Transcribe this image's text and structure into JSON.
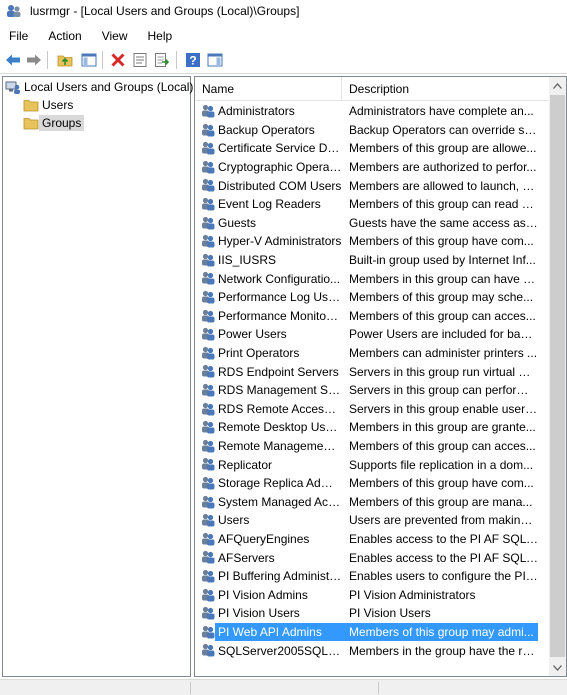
{
  "window": {
    "title": "lusrmgr - [Local Users and Groups (Local)\\Groups]",
    "icon": "users-app-icon"
  },
  "menu": [
    "File",
    "Action",
    "View",
    "Help"
  ],
  "toolbar": {
    "buttons": [
      "back-icon",
      "forward-icon",
      "up-folder-icon",
      "show-hide-tree-icon",
      "delete-icon",
      "properties-icon",
      "export-list-icon",
      "help-icon",
      "show-hide-action-pane-icon"
    ]
  },
  "tree": {
    "root": "Local Users and Groups (Local)",
    "children": [
      "Users",
      "Groups"
    ],
    "selected": "Groups"
  },
  "list": {
    "columns": {
      "name": "Name",
      "description": "Description"
    },
    "selected_index": 28,
    "rows": [
      {
        "name": "Administrators",
        "description": "Administrators have complete an..."
      },
      {
        "name": "Backup Operators",
        "description": "Backup Operators can override se..."
      },
      {
        "name": "Certificate Service DC...",
        "description": "Members of this group are allowe..."
      },
      {
        "name": "Cryptographic Operat...",
        "description": "Members are authorized to perfor..."
      },
      {
        "name": "Distributed COM Users",
        "description": "Members are allowed to launch, a..."
      },
      {
        "name": "Event Log Readers",
        "description": "Members of this group can read e..."
      },
      {
        "name": "Guests",
        "description": "Guests have the same access as m..."
      },
      {
        "name": "Hyper-V Administrators",
        "description": "Members of this group have com..."
      },
      {
        "name": "IIS_IUSRS",
        "description": "Built-in group used by Internet Inf..."
      },
      {
        "name": "Network Configuratio...",
        "description": "Members in this group can have s..."
      },
      {
        "name": "Performance Log Users",
        "description": "Members of this group may sche..."
      },
      {
        "name": "Performance Monitor ...",
        "description": "Members of this group can acces..."
      },
      {
        "name": "Power Users",
        "description": "Power Users are included for back..."
      },
      {
        "name": "Print Operators",
        "description": "Members can administer printers ..."
      },
      {
        "name": "RDS Endpoint Servers",
        "description": "Servers in this group run virtual m..."
      },
      {
        "name": "RDS Management Ser...",
        "description": "Servers in this group can perform ..."
      },
      {
        "name": "RDS Remote Access S...",
        "description": "Servers in this group enable users ..."
      },
      {
        "name": "Remote Desktop Users",
        "description": "Members in this group are grante..."
      },
      {
        "name": "Remote Management...",
        "description": "Members of this group can acces..."
      },
      {
        "name": "Replicator",
        "description": "Supports file replication in a dom..."
      },
      {
        "name": "Storage Replica Admi...",
        "description": "Members of this group have com..."
      },
      {
        "name": "System Managed Acc...",
        "description": "Members of this group are mana..."
      },
      {
        "name": "Users",
        "description": "Users are prevented from making ..."
      },
      {
        "name": "AFQueryEngines",
        "description": "Enables access to the PI AF SQL D..."
      },
      {
        "name": "AFServers",
        "description": "Enables access to the PI AF SQL D..."
      },
      {
        "name": "PI Buffering Administr...",
        "description": "Enables users to configure the PI ..."
      },
      {
        "name": "PI Vision Admins",
        "description": "PI Vision Administrators"
      },
      {
        "name": "PI Vision Users",
        "description": "PI Vision Users"
      },
      {
        "name": "PI Web API Admins",
        "description": "Members of this group may admi..."
      },
      {
        "name": "SQLServer2005SQLBro...",
        "description": "Members in the group have the re..."
      }
    ]
  },
  "colors": {
    "selection": "#3399ff",
    "tree_selection": "#d9d9d9",
    "folder": "#e8c25a"
  }
}
